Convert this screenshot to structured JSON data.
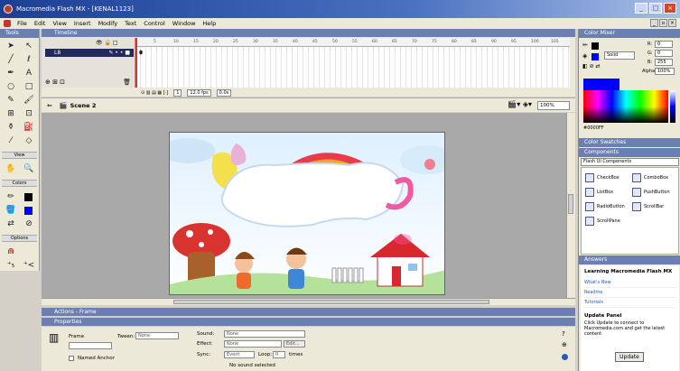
{
  "window": {
    "title": "Macromedia Flash MX - [KENAL1123]"
  },
  "menu": [
    "File",
    "Edit",
    "View",
    "Insert",
    "Modify",
    "Text",
    "Control",
    "Window",
    "Help"
  ],
  "tools": {
    "header": "Tools",
    "view_label": "View",
    "colors_label": "Colors",
    "options_label": "Options"
  },
  "timeline": {
    "header": "Timeline",
    "layer_name": "L8",
    "ruler": [
      "5",
      "10",
      "15",
      "20",
      "25",
      "30",
      "35",
      "40",
      "45",
      "50",
      "55",
      "60",
      "65",
      "70",
      "75",
      "80",
      "85",
      "90",
      "95",
      "100",
      "105"
    ],
    "frame": "1",
    "fps": "12.0 fps",
    "time": "0.0s"
  },
  "scene": {
    "name": "Scene 2",
    "zoom": "100%"
  },
  "panels": {
    "actions": "Actions - Frame",
    "properties": "Properties"
  },
  "properties": {
    "frame_label": "Frame",
    "tween_label": "Tween:",
    "tween_value": "None",
    "sound_label": "Sound:",
    "sound_value": "None",
    "effect_label": "Effect:",
    "effect_value": "None",
    "edit_button": "Edit...",
    "sync_label": "Sync:",
    "sync_value": "Event",
    "loop_label": "Loop:",
    "loop_value": "0",
    "times_label": "times",
    "no_sound": "No sound selected",
    "named_anchor": "Named Anchor"
  },
  "color_mixer": {
    "header": "Color Mixer",
    "fill_type": "Solid",
    "r": "0",
    "g": "0",
    "b": "255",
    "alpha": "100%",
    "hex": "#0000FF"
  },
  "swatches": {
    "header": "Color Swatches"
  },
  "components": {
    "header": "Components",
    "set": "Flash UI Components",
    "items": [
      "CheckBox",
      "ComboBox",
      "ListBox",
      "PushButton",
      "RadioButton",
      "ScrollBar",
      "ScrollPane"
    ]
  },
  "answers": {
    "header": "Answers",
    "title": "Learning Macromedia Flash MX",
    "links": [
      "What's New",
      "Readme",
      "Tutorials"
    ],
    "update_title": "Update Panel",
    "update_text": "Click Update to connect to Macromedia.com and get the latest content",
    "update_button": "Update"
  }
}
